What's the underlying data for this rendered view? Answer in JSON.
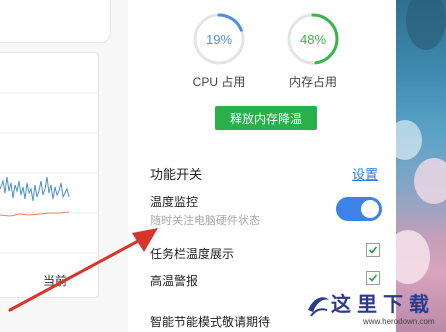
{
  "left": {
    "chart_footer_label": "当前"
  },
  "gauges": {
    "cpu": {
      "value": "19%",
      "label": "CPU 占用",
      "percent": 19,
      "color": "#4b90e2"
    },
    "memory": {
      "value": "48%",
      "label": "内存占用",
      "percent": 48,
      "color": "#39b54a"
    }
  },
  "release_button": {
    "label": "释放内存降温"
  },
  "features": {
    "title": "功能开关",
    "settings_link": "设置",
    "temp_monitor": {
      "title": "温度监控",
      "subtitle": "随时关注电脑硬件状态",
      "enabled": true
    },
    "taskbar_temp": {
      "label": "任务栏温度展示",
      "checked": true
    },
    "high_temp_alert": {
      "label": "高温警报",
      "checked": true
    },
    "smart_power": {
      "label": "智能节能模式敬请期待"
    }
  },
  "watermark": {
    "text": "这里下载",
    "url": "www.herodown.com"
  },
  "colors": {
    "accent_blue": "#3d82e6",
    "accent_green": "#28b04a",
    "annotation_red": "#d9342b",
    "link": "#2d7fd7"
  }
}
